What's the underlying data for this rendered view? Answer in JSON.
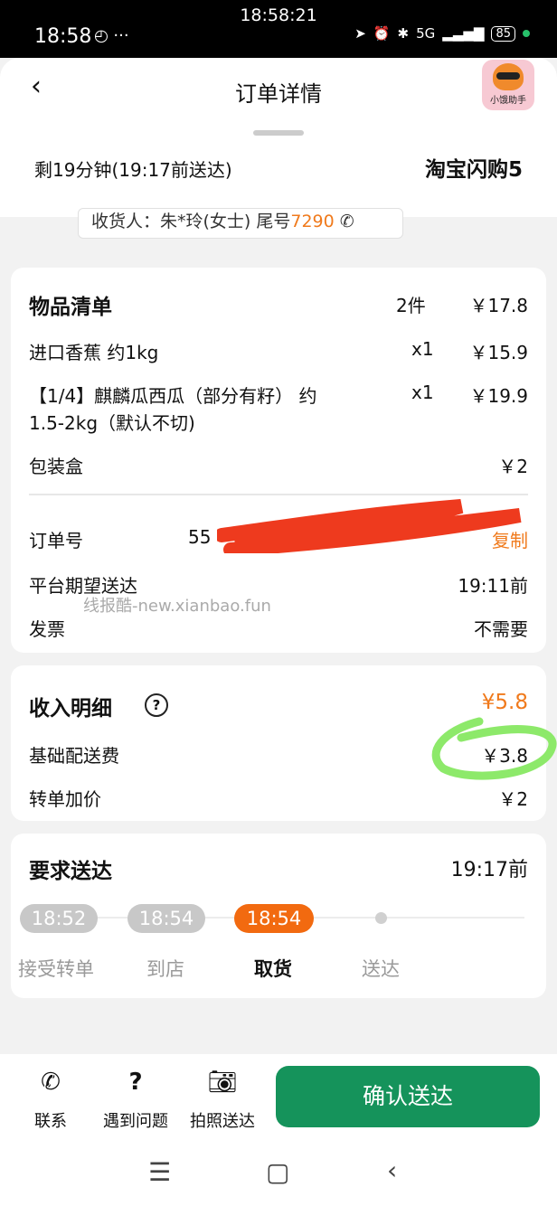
{
  "status_bar": {
    "clock_overlay": "18:58:21",
    "time": "18:58",
    "network": "5G",
    "battery": "85"
  },
  "header": {
    "title": "订单详情",
    "assistant_label": "小饿助手"
  },
  "summary": {
    "remaining": "剩19分钟(19:17前送达)",
    "shop": "淘宝闪购5",
    "receiver": "收货人：朱*玲(女士) 尾号",
    "receiver_tail": "7290"
  },
  "items": {
    "title": "物品清单",
    "count": "2件",
    "total": "￥17.8",
    "list": [
      {
        "name": "进口香蕉 约1kg",
        "qty": "x1",
        "price": "￥15.9"
      },
      {
        "name": "【1/4】麒麟瓜西瓜（部分有籽） 约",
        "name_line2": "1.5-2kg（默认不切)",
        "qty": "x1",
        "price": "￥19.9"
      }
    ],
    "box_label": "包装盒",
    "box_price": "￥2"
  },
  "order_info": {
    "order_no_label": "订单号",
    "order_no_visible": "55",
    "copy_label": "复制",
    "expected_label": "平台期望送达",
    "expected_value": "19:11前",
    "invoice_label": "发票",
    "invoice_value": "不需要",
    "watermark": "线报酷-new.xianbao.fun"
  },
  "income": {
    "title": "收入明细",
    "help_icon": "?",
    "total": "¥5.8",
    "base_label": "基础配送费",
    "base_value": "￥3.8",
    "extra_label": "转单加价",
    "extra_value": "￥2"
  },
  "delivery": {
    "title": "要求送达",
    "deadline": "19:17前",
    "times": [
      "18:52",
      "18:54",
      "18:54"
    ],
    "steps": [
      "接受转单",
      "到店",
      "取货",
      "送达"
    ]
  },
  "actions": {
    "contact": "联系",
    "problem": "遇到问题",
    "photo": "拍照送达",
    "confirm": "确认送达"
  },
  "colors": {
    "accent_orange": "#f26a10",
    "confirm_green": "#15935b"
  }
}
